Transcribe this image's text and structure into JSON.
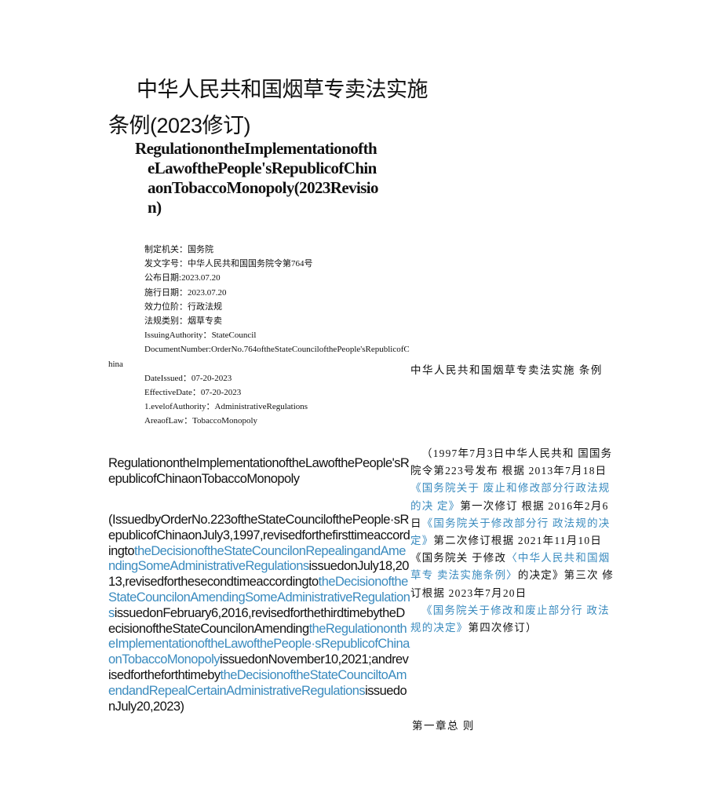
{
  "title": {
    "cn_line1": "中华人民共和国烟草专卖法实施",
    "cn_line2": "条例(2023修订)",
    "en_lines": [
      "RegulationontheImplementationofth",
      "eLawofthePeople'sRepublicofChin",
      "aonTobaccoMonopoly(2023Revisio",
      "n)"
    ]
  },
  "meta": {
    "cn": [
      {
        "label": "制定机关：",
        "value": "国务院"
      },
      {
        "label": "发文字号：",
        "value": "中华人民共和国国务院令第764号"
      },
      {
        "label": "公布日期:",
        "value": "2023.07.20"
      },
      {
        "label": "施行日期：",
        "value": "2023.07.20"
      },
      {
        "label": "效力位阶：",
        "value": "行政法规"
      },
      {
        "label": "法规类别：",
        "value": "烟草专卖"
      }
    ],
    "en": [
      {
        "label": "IssuingAuthority：",
        "value": "StateCouncil"
      },
      {
        "label": "DocumentNumber:",
        "value": "OrderNo.764oftheStateCouncilofthePeople'sRepublicofChina"
      },
      {
        "label": "DateIssued：",
        "value": "07-20-2023"
      },
      {
        "label": "EffectiveDate：",
        "value": "07-20-2023"
      },
      {
        "label": "1.evelofAuthority：",
        "value": "AdministrativeRegulations"
      },
      {
        "label": "AreaofLaw：",
        "value": "TobaccoMonopoly"
      }
    ]
  },
  "english": {
    "heading": "RegulationontheImplementationoftheLawofthePeople'sRepublicofChinaonTobaccoMonopoly",
    "body": [
      {
        "text": "(IssuedbyOrderNo.223oftheStateCouncilofthePeople·sRepublicofChinaonJuly3,1997,revisedforthefirsttimeaccordingto",
        "link": false
      },
      {
        "text": "theDecisionoftheStateCouncilonRepealingandAmendingSomeAdministrativeRegulations",
        "link": true
      },
      {
        "text": "issuedonJuly18,2013,revisedforthesecondtimeaccordingto",
        "link": false
      },
      {
        "text": "theDecisionoftheStateCouncilonAmendingSomeAdministrativeRegulations",
        "link": true
      },
      {
        "text": "issuedonFebruary6,2016,revisedforthethirdtimebytheDecisionoftheStateCouncilonAmending",
        "link": false
      },
      {
        "text": "theRegulationontheImplementationoftheLawofthePeople·sRepublicofChinaonTobaccoMonopoly",
        "link": true
      },
      {
        "text": "issuedonNovember10,2021;andrevisedfortheforthtimeby",
        "link": false
      },
      {
        "text": "theDecisionoftheStateCounciltoAmendandRepealCertainAdministrativeRegulations",
        "link": true
      },
      {
        "text": "issuedonJuly20,2023)",
        "link": false
      }
    ]
  },
  "chinese": {
    "heading": "中华人民共和国烟草专卖法实施 条例",
    "body": [
      {
        "text": "（1997年7月3日中华人民共和 国国务院令第223号发布 根据 2013年7月18日",
        "link": false
      },
      {
        "text": "《国务院关于 废止和修改部分行政法规的决 定》",
        "link": true
      },
      {
        "text": "第一次修订 根据 2016年2月6日",
        "link": false
      },
      {
        "text": "《国务院关于修改部分行 政法规的决定》",
        "link": true
      },
      {
        "text": "第二次修订根据 2021年11月10日《国务院关 于修改",
        "link": false
      },
      {
        "text": "〈中华人民共和国烟草专 卖法实施条例〉",
        "link": true
      },
      {
        "text": "的决定》第三次 修订根据 2023年7月20日",
        "link": false
      }
    ],
    "body2": [
      {
        "text": "《国务院关于修改和废止部分行 政法规的决定》",
        "link": true
      },
      {
        "text": "第四次修订）",
        "link": false
      }
    ],
    "chapter": "第一章总 则"
  },
  "colors": {
    "text": "#111111",
    "link": "#3a8bbf"
  }
}
